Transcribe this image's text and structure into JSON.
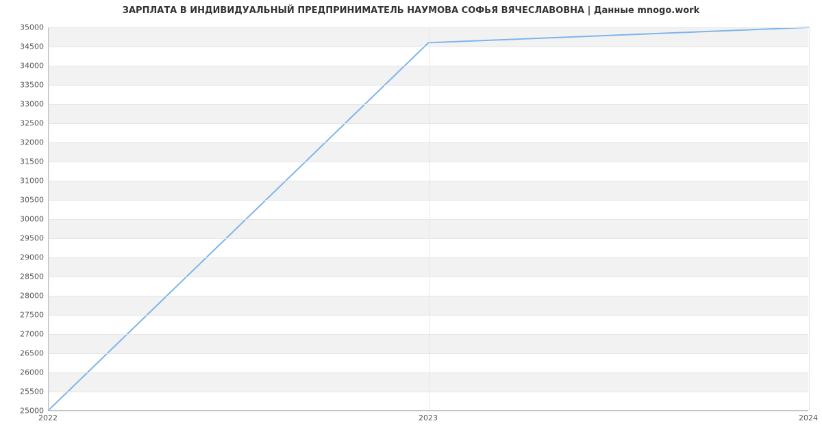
{
  "chart_data": {
    "type": "line",
    "title": "ЗАРПЛАТА В ИНДИВИДУАЛЬНЫЙ ПРЕДПРИНИМАТЕЛЬ НАУМОВА СОФЬЯ ВЯЧЕСЛАВОВНА | Данные mnogo.work",
    "x": [
      2022,
      2023,
      2024
    ],
    "values": [
      25000,
      34600,
      35000
    ],
    "xlabel": "",
    "ylabel": "",
    "xlim": [
      2022,
      2024
    ],
    "ylim": [
      25000,
      35000
    ],
    "y_ticks": [
      25000,
      25500,
      26000,
      26500,
      27000,
      27500,
      28000,
      28500,
      29000,
      29500,
      30000,
      30500,
      31000,
      31500,
      32000,
      32500,
      33000,
      33500,
      34000,
      34500,
      35000
    ],
    "x_ticks": [
      2022,
      2023,
      2024
    ],
    "grid": true,
    "line_color": "#7cb5ec"
  }
}
